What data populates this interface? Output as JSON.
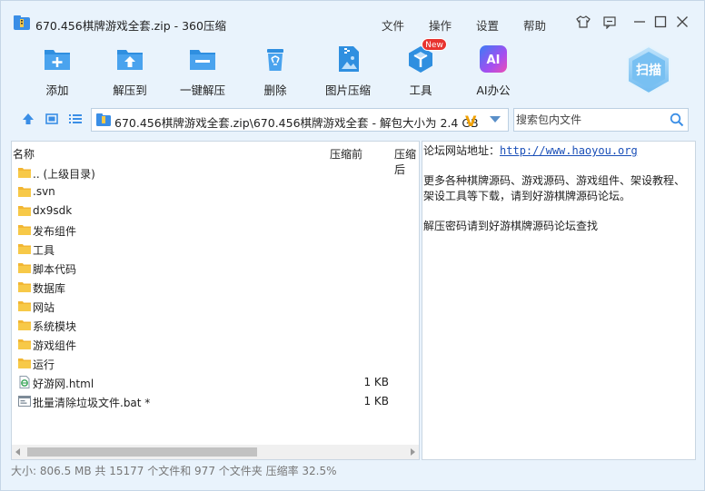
{
  "title_bar": {
    "title": "670.456棋牌游戏全套.zip - 360压缩",
    "menu": [
      "文件",
      "操作",
      "设置",
      "帮助"
    ]
  },
  "toolbar": {
    "items": [
      {
        "label": "添加",
        "icon": "add-icon"
      },
      {
        "label": "解压到",
        "icon": "extract-to-icon"
      },
      {
        "label": "一键解压",
        "icon": "one-click-extract-icon"
      },
      {
        "label": "删除",
        "icon": "trash-icon"
      },
      {
        "label": "图片压缩",
        "icon": "image-compress-icon"
      },
      {
        "label": "工具",
        "icon": "tools-icon"
      },
      {
        "label": "AI办公",
        "icon": "ai-office-icon"
      }
    ],
    "new_badge": "New",
    "scan_label": "扫描",
    "ai_badge": "AI"
  },
  "address": {
    "path": "670.456棋牌游戏全套.zip\\670.456棋牌游戏全套 - 解包大小为 2.4 GB",
    "search_placeholder": "搜索包内文件"
  },
  "columns": {
    "name": "名称",
    "compressed": "压缩前",
    "packed": "压缩后"
  },
  "files": [
    {
      "name": ".. (上级目录)",
      "type": "folder",
      "size": ""
    },
    {
      "name": ".svn",
      "type": "folder",
      "size": ""
    },
    {
      "name": "dx9sdk",
      "type": "folder",
      "size": ""
    },
    {
      "name": "发布组件",
      "type": "folder",
      "size": ""
    },
    {
      "name": "工具",
      "type": "folder",
      "size": ""
    },
    {
      "name": "脚本代码",
      "type": "folder",
      "size": ""
    },
    {
      "name": "数据库",
      "type": "folder",
      "size": ""
    },
    {
      "name": "网站",
      "type": "folder",
      "size": ""
    },
    {
      "name": "系统模块",
      "type": "folder",
      "size": ""
    },
    {
      "name": "游戏组件",
      "type": "folder",
      "size": ""
    },
    {
      "name": "运行",
      "type": "folder",
      "size": ""
    },
    {
      "name": "好游网.html",
      "type": "html",
      "size": "1 KB"
    },
    {
      "name": "批量清除垃圾文件.bat *",
      "type": "bat",
      "size": "1 KB"
    }
  ],
  "comment": {
    "line1_prefix": "论坛网站地址：",
    "line1_link": "http://www.haoyou.org",
    "line2": "更多各种棋牌源码、游戏源码、游戏组件、架设教程、架设工具等下载，请到好游棋牌源码论坛。",
    "line3": "解压密码请到好游棋牌源码论坛查找"
  },
  "status": {
    "text": "大小: 806.5 MB 共 15177 个文件和 977 个文件夹 压缩率 32.5%"
  },
  "colors": {
    "accent": "#2f8fe0",
    "window_bg": "#e9f3fc",
    "folder": "#f7c948",
    "link": "#1a4fb8"
  }
}
